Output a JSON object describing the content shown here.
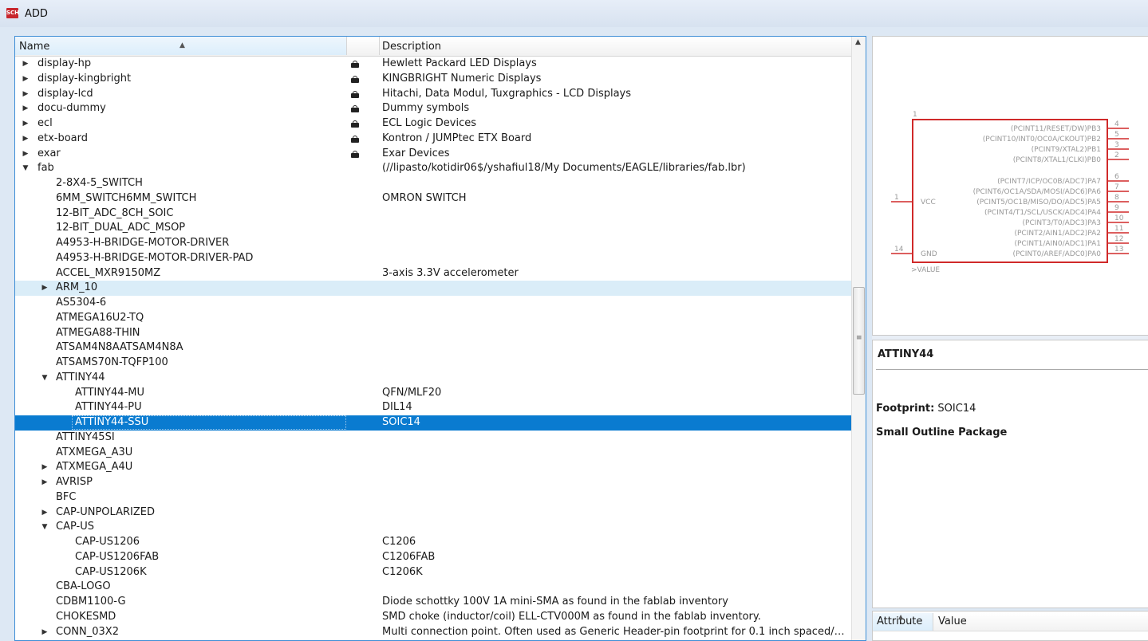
{
  "window": {
    "title": "ADD",
    "icon": "sch-icon"
  },
  "tree": {
    "columns": {
      "name": "Name",
      "description": "Description"
    },
    "rows": [
      {
        "name": "display-hp",
        "desc": "Hewlett Packard LED Displays",
        "level": 0,
        "expander": "collapsed",
        "lock": true
      },
      {
        "name": "display-kingbright",
        "desc": "KINGBRIGHT Numeric Displays",
        "level": 0,
        "expander": "collapsed",
        "lock": true
      },
      {
        "name": "display-lcd",
        "desc": "Hitachi, Data Modul, Tuxgraphics - LCD Displays",
        "level": 0,
        "expander": "collapsed",
        "lock": true
      },
      {
        "name": "docu-dummy",
        "desc": "Dummy symbols",
        "level": 0,
        "expander": "collapsed",
        "lock": true
      },
      {
        "name": "ecl",
        "desc": "ECL Logic Devices",
        "level": 0,
        "expander": "collapsed",
        "lock": true
      },
      {
        "name": "etx-board",
        "desc": "Kontron / JUMPtec ETX Board",
        "level": 0,
        "expander": "collapsed",
        "lock": true
      },
      {
        "name": "exar",
        "desc": "Exar Devices",
        "level": 0,
        "expander": "collapsed",
        "lock": true
      },
      {
        "name": "fab",
        "desc": "(//lipasto/kotidir06$/yshafiul18/My Documents/EAGLE/libraries/fab.lbr)",
        "level": 0,
        "expander": "expanded",
        "lock": false
      },
      {
        "name": "2-8X4-5_SWITCH",
        "desc": "",
        "level": 1,
        "expander": "none",
        "lock": false
      },
      {
        "name": "6MM_SWITCH6MM_SWITCH",
        "desc": "OMRON SWITCH",
        "level": 1,
        "expander": "none",
        "lock": false
      },
      {
        "name": "12-BIT_ADC_8CH_SOIC",
        "desc": "",
        "level": 1,
        "expander": "none",
        "lock": false
      },
      {
        "name": "12-BIT_DUAL_ADC_MSOP",
        "desc": "",
        "level": 1,
        "expander": "none",
        "lock": false
      },
      {
        "name": "A4953-H-BRIDGE-MOTOR-DRIVER",
        "desc": "",
        "level": 1,
        "expander": "none",
        "lock": false
      },
      {
        "name": "A4953-H-BRIDGE-MOTOR-DRIVER-PAD",
        "desc": "",
        "level": 1,
        "expander": "none",
        "lock": false
      },
      {
        "name": "ACCEL_MXR9150MZ",
        "desc": "3-axis 3.3V accelerometer",
        "level": 1,
        "expander": "none",
        "lock": false
      },
      {
        "name": "ARM_10",
        "desc": "",
        "level": 1,
        "expander": "collapsed",
        "lock": false,
        "state": "hover"
      },
      {
        "name": "AS5304-6",
        "desc": "",
        "level": 1,
        "expander": "none",
        "lock": false
      },
      {
        "name": "ATMEGA16U2-TQ",
        "desc": "",
        "level": 1,
        "expander": "none",
        "lock": false
      },
      {
        "name": "ATMEGA88-THIN",
        "desc": "",
        "level": 1,
        "expander": "none",
        "lock": false
      },
      {
        "name": "ATSAM4N8AATSAM4N8A",
        "desc": "",
        "level": 1,
        "expander": "none",
        "lock": false
      },
      {
        "name": "ATSAMS70N-TQFP100",
        "desc": "",
        "level": 1,
        "expander": "none",
        "lock": false
      },
      {
        "name": "ATTINY44",
        "desc": "",
        "level": 1,
        "expander": "expanded",
        "lock": false
      },
      {
        "name": "ATTINY44-MU",
        "desc": "QFN/MLF20",
        "level": 2,
        "expander": "none",
        "lock": false
      },
      {
        "name": "ATTINY44-PU",
        "desc": "DIL14",
        "level": 2,
        "expander": "none",
        "lock": false
      },
      {
        "name": "ATTINY44-SSU",
        "desc": "SOIC14",
        "level": 2,
        "expander": "none",
        "lock": false,
        "state": "selected"
      },
      {
        "name": "ATTINY45SI",
        "desc": "",
        "level": 1,
        "expander": "none",
        "lock": false
      },
      {
        "name": "ATXMEGA_A3U",
        "desc": "",
        "level": 1,
        "expander": "none",
        "lock": false
      },
      {
        "name": "ATXMEGA_A4U",
        "desc": "",
        "level": 1,
        "expander": "collapsed",
        "lock": false
      },
      {
        "name": "AVRISP",
        "desc": "",
        "level": 1,
        "expander": "collapsed",
        "lock": false
      },
      {
        "name": "BFC",
        "desc": "",
        "level": 1,
        "expander": "none",
        "lock": false
      },
      {
        "name": "CAP-UNPOLARIZED",
        "desc": "",
        "level": 1,
        "expander": "collapsed",
        "lock": false
      },
      {
        "name": "CAP-US",
        "desc": "",
        "level": 1,
        "expander": "expanded",
        "lock": false
      },
      {
        "name": "CAP-US1206",
        "desc": "C1206",
        "level": 2,
        "expander": "none",
        "lock": false
      },
      {
        "name": "CAP-US1206FAB",
        "desc": "C1206FAB",
        "level": 2,
        "expander": "none",
        "lock": false
      },
      {
        "name": "CAP-US1206K",
        "desc": "C1206K",
        "level": 2,
        "expander": "none",
        "lock": false
      },
      {
        "name": "CBA-LOGO",
        "desc": "",
        "level": 1,
        "expander": "none",
        "lock": false
      },
      {
        "name": "CDBM1100-G",
        "desc": "Diode schottky 100V 1A mini-SMA as found in the fablab inventory",
        "level": 1,
        "expander": "none",
        "lock": false
      },
      {
        "name": "CHOKESMD",
        "desc": "SMD choke (inductor/coil) ELL-CTV000M as found in the fablab inventory.",
        "level": 1,
        "expander": "none",
        "lock": false
      },
      {
        "name": "CONN_03X2",
        "desc": "Multi connection point. Often used as Generic Header-pin footprint for 0.1 inch spaced/s...",
        "level": 1,
        "expander": "collapsed",
        "lock": false
      }
    ]
  },
  "symbol": {
    "top_pin_number": "1",
    "left_pins": [
      {
        "num": "1",
        "label": "VCC"
      },
      {
        "num": "14",
        "label": "GND"
      }
    ],
    "right_pins": [
      {
        "num": "4",
        "label": "(PCINT11/RESET/DW)PB3"
      },
      {
        "num": "5",
        "label": "(PCINT10/INT0/OC0A/CKOUT)PB2"
      },
      {
        "num": "3",
        "label": "(PCINT9/XTAL2)PB1"
      },
      {
        "num": "2",
        "label": "(PCINT8/XTAL1/CLKI)PB0"
      },
      {
        "num": "6",
        "label": "(PCINT7/ICP/OC0B/ADC7)PA7"
      },
      {
        "num": "7",
        "label": "(PCINT6/OC1A/SDA/MOSI/ADC6)PA6"
      },
      {
        "num": "8",
        "label": "(PCINT5/OC1B/MISO/DO/ADC5)PA5"
      },
      {
        "num": "9",
        "label": "(PCINT4/T1/SCL/USCK/ADC4)PA4"
      },
      {
        "num": "10",
        "label": "(PCINT3/T0/ADC3)PA3"
      },
      {
        "num": "11",
        "label": "(PCINT2/AIN1/ADC2)PA2"
      },
      {
        "num": "12",
        "label": "(PCINT1/AIN0/ADC1)PA1"
      },
      {
        "num": "13",
        "label": "(PCINT0/AREF/ADC0)PA0"
      }
    ],
    "value_label": ">VALUE",
    "outline_color": "#d02a2a"
  },
  "info": {
    "device": "ATTINY44",
    "footprint_label": "Footprint:",
    "footprint_value": "SOIC14",
    "package_desc": "Small Outline Package"
  },
  "attributes": {
    "col_attribute": "Attribute",
    "col_value": "Value"
  },
  "colors": {
    "selection": "#0a7bd0",
    "hover": "#daedf8",
    "focus_border": "#3e8ed6"
  }
}
